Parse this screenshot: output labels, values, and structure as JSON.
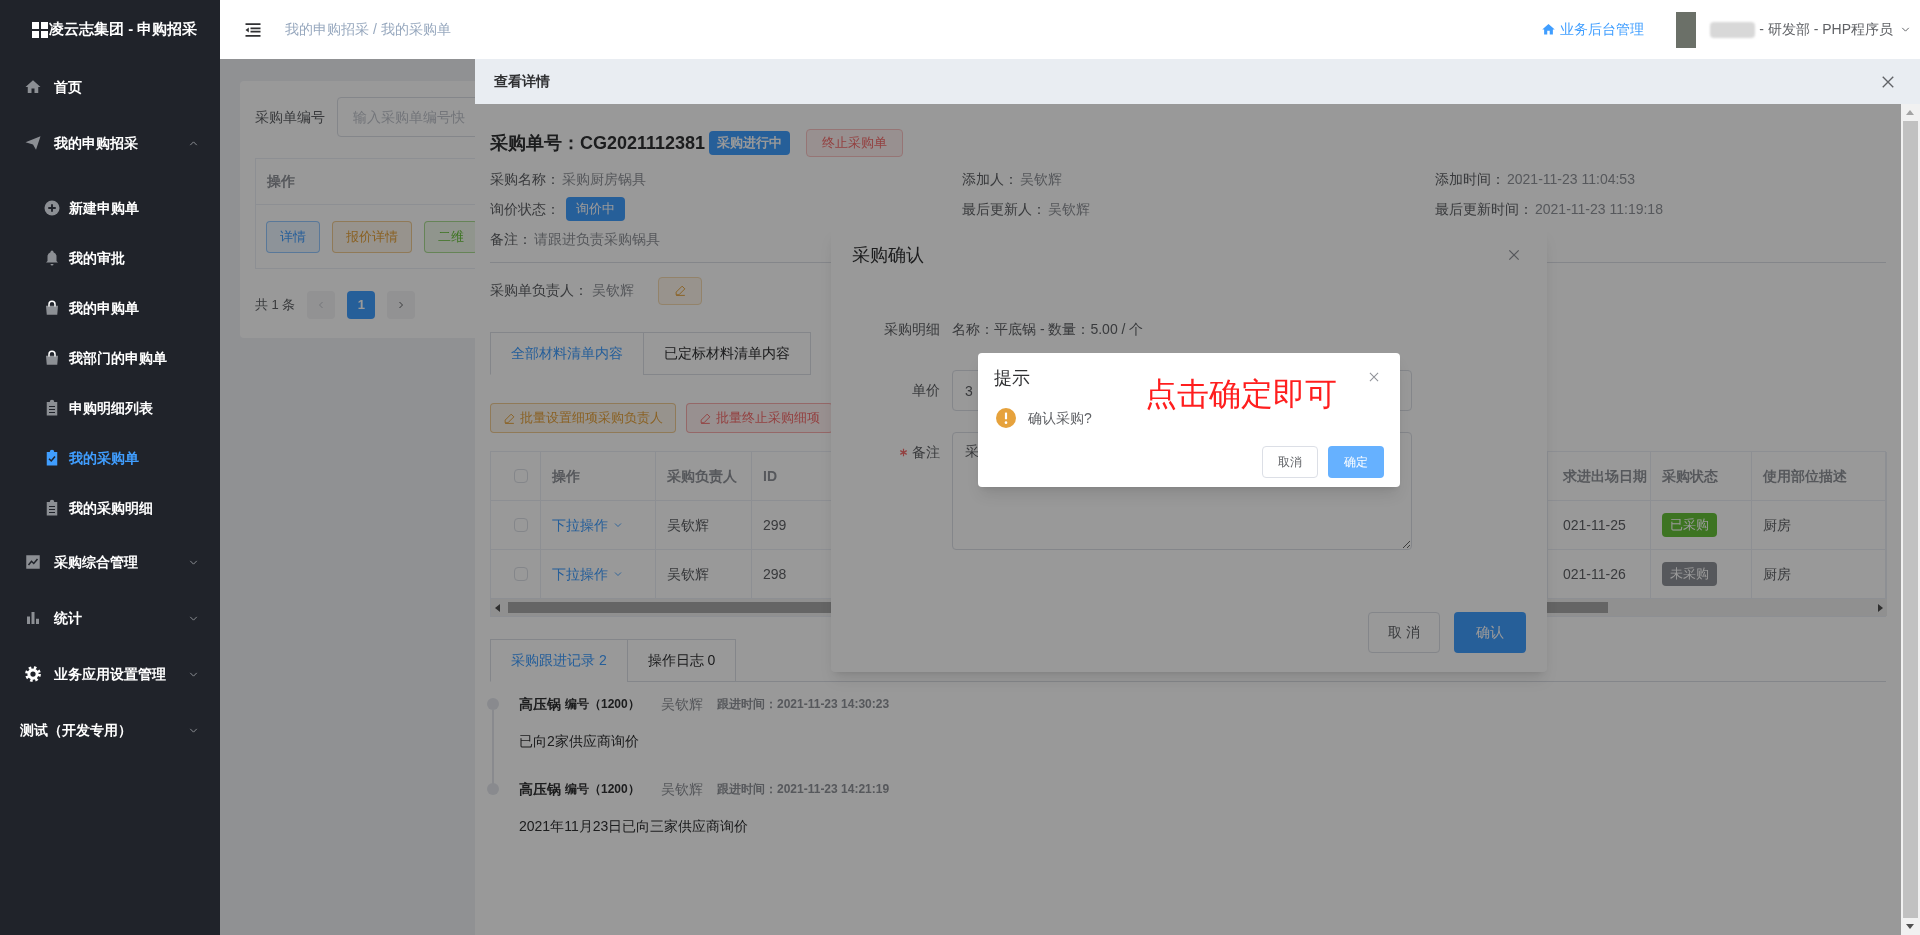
{
  "sidebar": {
    "title": "凌云志集团 - 申购招采",
    "items": [
      {
        "label": "首页",
        "kind": "link",
        "selected": false
      },
      {
        "label": "我的申购招采",
        "kind": "group",
        "selected": false,
        "expanded": true,
        "children": [
          {
            "label": "新建申购单",
            "selected": false
          },
          {
            "label": "我的审批",
            "selected": false
          },
          {
            "label": "我的申购单",
            "selected": false
          },
          {
            "label": "我部门的申购单",
            "selected": false
          },
          {
            "label": "申购明细列表",
            "selected": false
          },
          {
            "label": "我的采购单",
            "selected": true
          },
          {
            "label": "我的采购明细",
            "selected": false
          }
        ]
      },
      {
        "label": "采购综合管理",
        "kind": "group",
        "selected": false,
        "expanded": false
      },
      {
        "label": "统计",
        "kind": "group",
        "selected": false,
        "expanded": false
      },
      {
        "label": "业务应用设置管理",
        "kind": "group",
        "selected": false,
        "expanded": false
      },
      {
        "label": "测试（开发专用）",
        "kind": "group",
        "selected": false,
        "expanded": false
      }
    ]
  },
  "header": {
    "breadcrumb": "我的申购招采 / 我的采购单",
    "admin_link": "业务后台管理",
    "user_role": "- 研发部 - PHP程序员"
  },
  "page": {
    "filter": {
      "label": "采购单编号",
      "placeholder": "输入采购单编号快"
    },
    "table": {
      "columns": [
        "操作"
      ],
      "actions": [
        {
          "label": "详情",
          "kind": "primary"
        },
        {
          "label": "报价详情",
          "kind": "warning"
        },
        {
          "label": "二维",
          "kind": "success"
        }
      ]
    },
    "pagination": {
      "total": "共 1 条",
      "pages": [
        {
          "label": "1",
          "selected": true
        }
      ]
    }
  },
  "drawer": {
    "title": "查看详情",
    "order_label": "采购单号：",
    "order_no": "CG2021112381",
    "status": "采购进行中",
    "terminate_button": "终止采购单",
    "info_columns": [
      {
        "fields": [
          {
            "kind": "text",
            "label": "采购名称：",
            "value": "采购厨房锅具"
          },
          {
            "kind": "tag",
            "label": "询价状态：",
            "value": "询价中"
          },
          {
            "kind": "text",
            "label": "备注：",
            "value": "请跟进负责采购锅具"
          }
        ]
      },
      {
        "fields": [
          {
            "kind": "text",
            "label": "添加人：",
            "value": "吴钦辉"
          },
          {
            "kind": "text",
            "label": "最后更新人：",
            "value": "吴钦辉"
          }
        ]
      },
      {
        "fields": [
          {
            "kind": "text",
            "label": "添加时间：",
            "value": "2021-11-23 11:04:53"
          },
          {
            "kind": "text",
            "label": "最后更新时间：",
            "value": "2021-11-23 11:19:18"
          }
        ]
      }
    ],
    "owner": {
      "label": "采购单负责人：",
      "value": "吴钦辉"
    },
    "tabs": [
      {
        "label": "全部材料清单内容",
        "selected": true
      },
      {
        "label": "已定标材料清单内容",
        "selected": false
      }
    ],
    "batch_buttons": [
      {
        "label": "批量设置细项采购负责人",
        "kind": "warning"
      },
      {
        "label": "批量终止采购细项",
        "kind": "danger"
      }
    ],
    "items_table": {
      "all_checked": false,
      "columns_left": [
        "操作",
        "采购负责人",
        "ID"
      ],
      "columns_right": [
        "求进出场日期",
        "采购状态",
        "使用部位描述"
      ],
      "rows": [
        {
          "checked": false,
          "action": "下拉操作",
          "owner": "吴钦辉",
          "id": "299",
          "date": "021-11-25",
          "status": {
            "label": "已采购",
            "kind": "success"
          },
          "location": "厨房"
        },
        {
          "checked": false,
          "action": "下拉操作",
          "owner": "吴钦辉",
          "id": "298",
          "date": "021-11-26",
          "status": {
            "label": "未采购",
            "kind": "info"
          },
          "location": "厨房"
        }
      ]
    },
    "log_tabs": [
      {
        "label": "采购跟进记录 2",
        "selected": true
      },
      {
        "label": "操作日志 0",
        "selected": false
      }
    ],
    "timeline": [
      {
        "title": "高压锅",
        "code": "编号（1200）",
        "author": "吴钦辉",
        "time": "跟进时间：2021-11-23 14:30:23",
        "content": "已向2家供应商询价"
      },
      {
        "title": "高压锅",
        "code": "编号（1200）",
        "author": "吴钦辉",
        "time": "跟进时间：2021-11-23 14:21:19",
        "content": "2021年11月23日已向三家供应商询价"
      }
    ]
  },
  "dialog": {
    "title": "采购确认",
    "fields": [
      {
        "kind": "text",
        "label": "采购明细",
        "required": false,
        "value": "名称：平底锅 - 数量：5.00 / 个"
      },
      {
        "kind": "input",
        "label": "单价",
        "required": false,
        "value": "3"
      },
      {
        "kind": "textarea",
        "label": "备注",
        "required": true,
        "value": "采"
      }
    ],
    "buttons": [
      {
        "label": "取 消",
        "kind": "default"
      },
      {
        "label": "确认",
        "kind": "primary"
      }
    ]
  },
  "message_box": {
    "title": "提示",
    "message": "确认采购?",
    "buttons": [
      {
        "label": "取消",
        "kind": "default"
      },
      {
        "label": "确定",
        "kind": "primary"
      }
    ]
  },
  "annotation": {
    "text": "点击确定即可"
  }
}
